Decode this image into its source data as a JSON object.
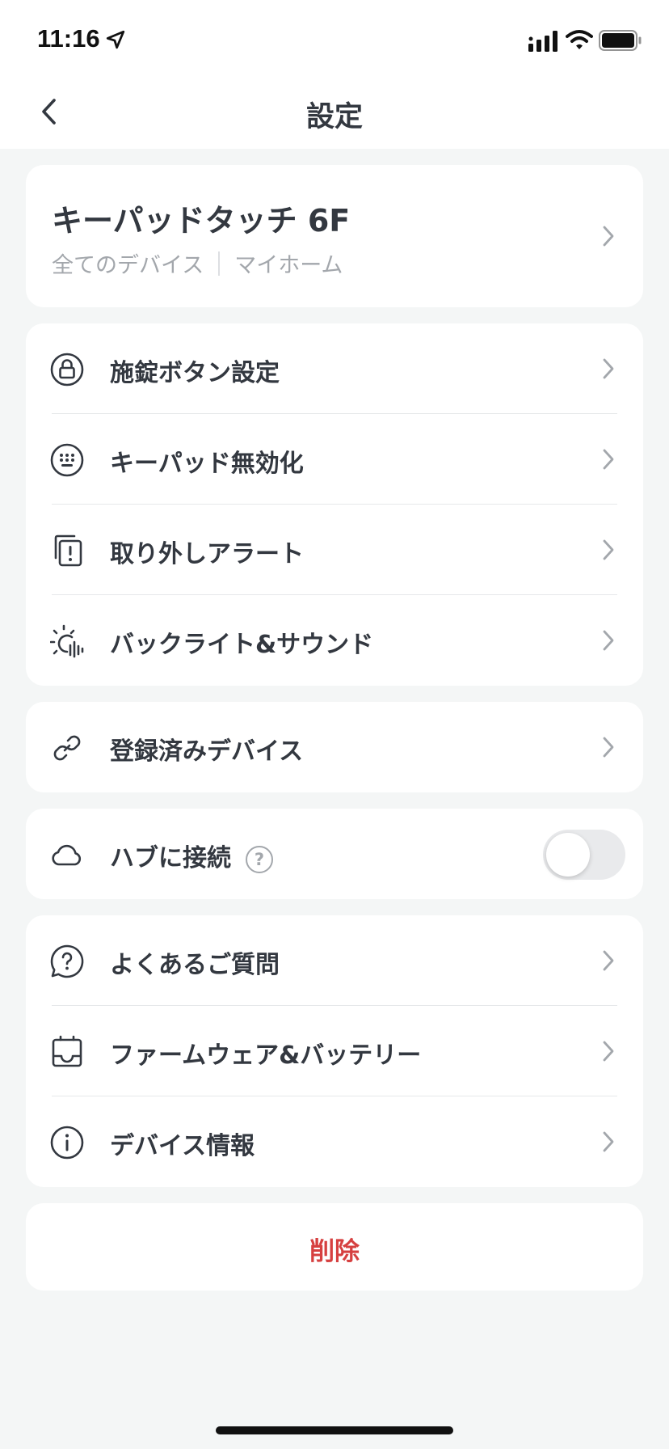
{
  "status": {
    "time": "11:16"
  },
  "nav": {
    "title": "設定"
  },
  "device": {
    "name": "キーパッドタッチ 6F",
    "meta_left": "全てのデバイス",
    "meta_right": "マイホーム"
  },
  "group1": [
    {
      "label": "施錠ボタン設定",
      "icon": "lock-icon"
    },
    {
      "label": "キーパッド無効化",
      "icon": "keypad-icon"
    },
    {
      "label": "取り外しアラート",
      "icon": "alert-icon"
    },
    {
      "label": "バックライト&サウンド",
      "icon": "backlight-sound-icon"
    }
  ],
  "group2": [
    {
      "label": "登録済みデバイス",
      "icon": "link-icon"
    }
  ],
  "hub": {
    "label": "ハブに接続",
    "help": "?",
    "toggle_on": false,
    "icon": "cloud-icon"
  },
  "group3": [
    {
      "label": "よくあるご質問",
      "icon": "faq-icon"
    },
    {
      "label": "ファームウェア&バッテリー",
      "icon": "firmware-icon"
    },
    {
      "label": "デバイス情報",
      "icon": "info-icon"
    }
  ],
  "delete": {
    "label": "削除"
  },
  "colors": {
    "text": "#333840",
    "muted": "#A3A7AC",
    "danger": "#D64040",
    "background": "#F4F6F6"
  }
}
